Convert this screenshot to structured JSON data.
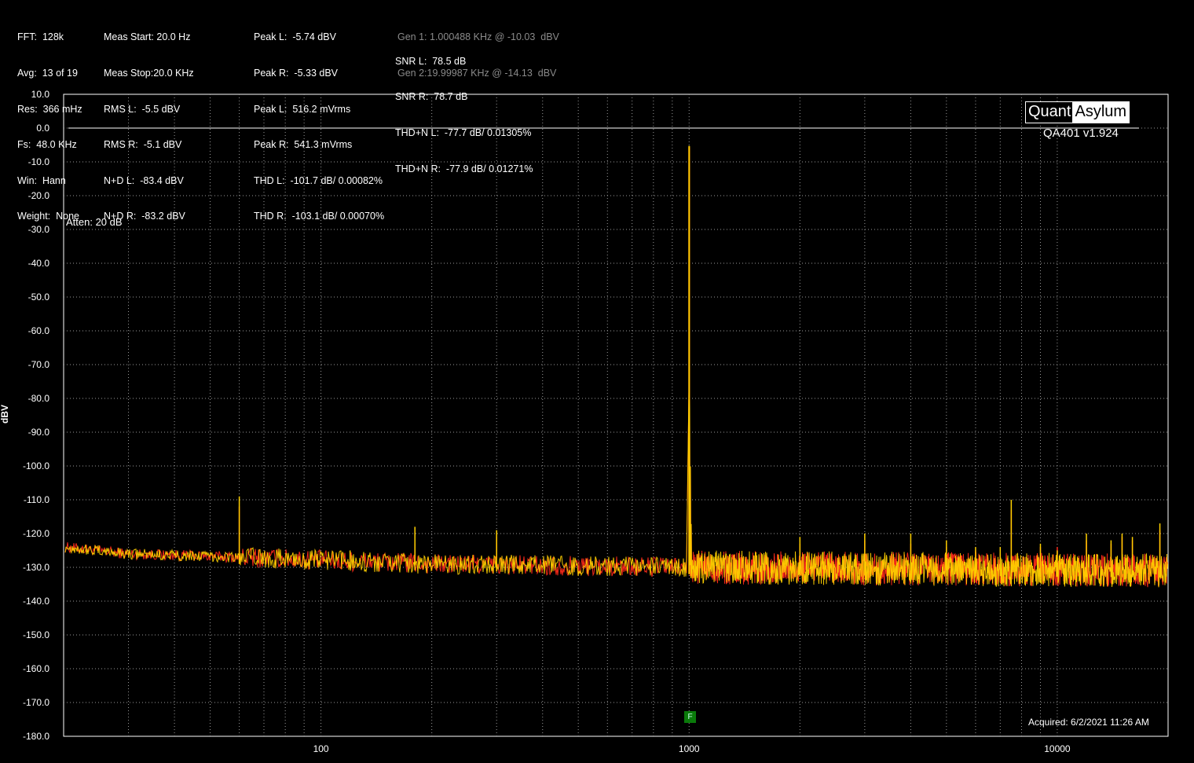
{
  "stats": {
    "col1": [
      "FFT:  128k",
      "Avg:  13 of 19",
      "Res:  366 mHz",
      "Fs:  48.0 KHz",
      "Win:  Hann",
      "Weight:  None"
    ],
    "col2": [
      "Meas Start: 20.0 Hz",
      "Meas Stop:20.0 KHz",
      "RMS L:  -5.5 dBV",
      "RMS R:  -5.1 dBV",
      "N+D L:  -83.4 dBV",
      "N+D R:  -83.2 dBV"
    ],
    "col3": [
      "Peak L:  -5.74 dBV",
      "Peak R:  -5.33 dBV",
      "Peak L:  516.2 mVrms",
      "Peak R:  541.3 mVrms",
      "THD L:  -101.7 dB/ 0.00082%",
      "THD R:  -103.1 dB/ 0.00070%"
    ],
    "col4_gen": [
      "Gen 1: 1.000488 KHz @ -10.03  dBV",
      "Gen 2:19.99987 KHz @ -14.13  dBV"
    ],
    "col4": [
      "SNR L:  78.5 dB",
      "SNR R:  78.7 dB",
      "THD+N L:  -77.7 dB/ 0.01305%",
      "THD+N R:  -77.9 dB/ 0.01271%"
    ]
  },
  "annotations": {
    "atten": "Atten: 20 dB",
    "logo_left": "Quant",
    "logo_right": "Asylum",
    "version": "QA401 v1.924",
    "acquired": "Acquired: 6/2/2021  11:26 AM",
    "marker": "F"
  },
  "chart_data": {
    "type": "line",
    "xscale": "log",
    "xlim": [
      20,
      20000
    ],
    "ylim": [
      -180,
      10
    ],
    "ylabel": "dBV",
    "xlabel": "",
    "grid": true,
    "x_ticks": [
      100,
      1000,
      10000
    ],
    "x_tick_labels": [
      "100",
      "1000",
      "10000"
    ],
    "y_ticks": [
      10,
      0,
      -10,
      -20,
      -30,
      -40,
      -50,
      -60,
      -70,
      -80,
      -90,
      -100,
      -110,
      -120,
      -130,
      -140,
      -150,
      -160,
      -170,
      -180
    ],
    "y_tick_labels": [
      "10.0",
      "0.0",
      "-10.0",
      "-20.0",
      "-30.0",
      "-40.0",
      "-50.0",
      "-60.0",
      "-70.0",
      "-80.0",
      "-90.0",
      "-100.0",
      "-110.0",
      "-120.0",
      "-130.0",
      "-140.0",
      "-150.0",
      "-160.0",
      "-170.0",
      "-180.0"
    ],
    "reference_line_y": 0,
    "noise_floor": {
      "x": [
        20,
        30,
        60,
        200,
        1000,
        5000,
        20000
      ],
      "y": [
        -124,
        -126,
        -127,
        -129,
        -130,
        -130.5,
        -131
      ]
    },
    "series": [
      {
        "color": "#ff2a1a",
        "peaks": [
          [
            60,
            -112
          ],
          [
            180,
            -123
          ],
          [
            300,
            -121
          ],
          [
            1000.5,
            -5.7
          ],
          [
            2000,
            -123
          ],
          [
            3000,
            -122
          ],
          [
            4000,
            -123
          ],
          [
            5000,
            -124
          ],
          [
            6000,
            -125
          ],
          [
            7000,
            -126
          ],
          [
            7500,
            -113
          ],
          [
            9000,
            -124
          ],
          [
            10000,
            -124
          ],
          [
            12000,
            -122
          ],
          [
            14000,
            -123
          ],
          [
            15000,
            -121
          ],
          [
            16000,
            -122
          ],
          [
            19000,
            -119
          ]
        ]
      },
      {
        "color": "#ffd000",
        "peaks": [
          [
            60,
            -109
          ],
          [
            120,
            -125
          ],
          [
            180,
            -118
          ],
          [
            300,
            -119
          ],
          [
            1000.5,
            -5.3
          ],
          [
            2000,
            -121
          ],
          [
            3000,
            -120
          ],
          [
            4000,
            -120
          ],
          [
            5000,
            -122
          ],
          [
            6000,
            -124
          ],
          [
            7000,
            -124
          ],
          [
            7500,
            -110
          ],
          [
            9000,
            -123
          ],
          [
            10000,
            -125
          ],
          [
            12000,
            -120
          ],
          [
            14000,
            -122
          ],
          [
            15000,
            -120
          ],
          [
            16000,
            -121
          ],
          [
            19000,
            -117
          ]
        ]
      }
    ]
  }
}
